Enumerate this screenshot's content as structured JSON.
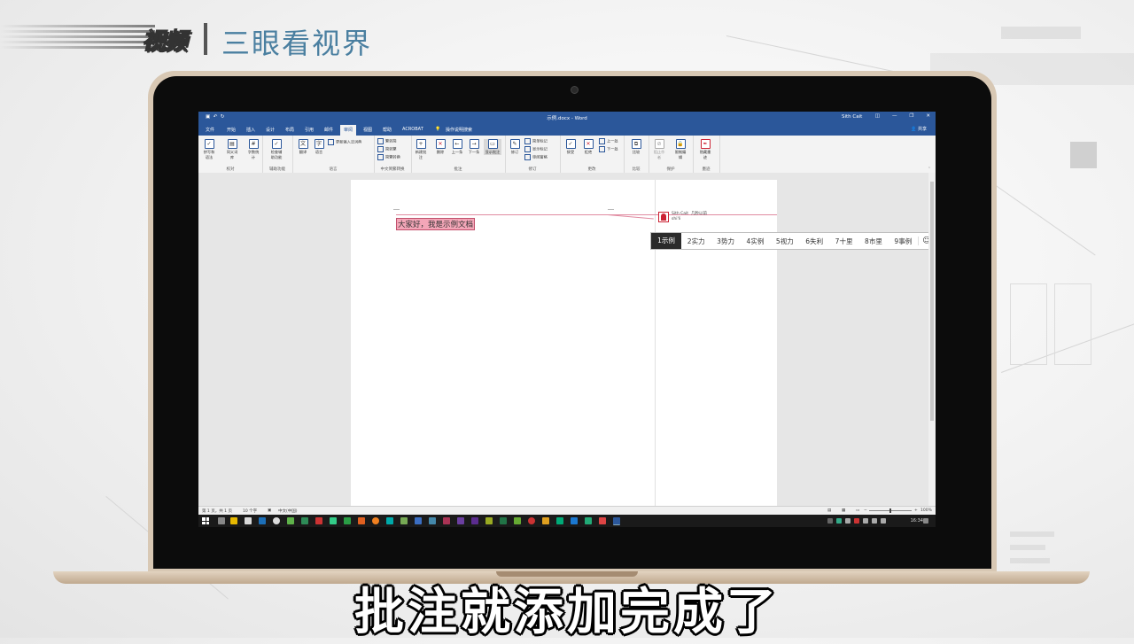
{
  "brand": {
    "video": "视频",
    "name": "三眼看视界"
  },
  "word": {
    "window_title": "示例.docx - Word",
    "user": "Sith Cait",
    "share": "共享",
    "tabs": [
      "文件",
      "开始",
      "插入",
      "设计",
      "布局",
      "引用",
      "邮件",
      "审阅",
      "视图",
      "帮助",
      "ACROBAT"
    ],
    "active_tab": "审阅",
    "tell_me": "操作说明搜索",
    "ribbon": {
      "proofing": {
        "buttons": [
          "拼写和语法",
          "同义词库",
          "字数统计"
        ],
        "label": "校对"
      },
      "accessibility": {
        "button": "检查辅助功能",
        "label": "辅助功能"
      },
      "language": {
        "buttons": [
          "翻译",
          "语言"
        ],
        "small": "更新输入法词典",
        "label": "语言"
      },
      "chinese": {
        "items": [
          "繁转简",
          "简转繁",
          "简繁转换"
        ],
        "label": "中文简繁转换"
      },
      "comments": {
        "buttons": [
          "新建批注",
          "删除",
          "上一条",
          "下一条",
          "显示批注"
        ],
        "label": "批注"
      },
      "tracking": {
        "button": "修订",
        "items": [
          "简单标记",
          "显示标记",
          "审阅窗格"
        ],
        "label": "修订"
      },
      "changes": {
        "buttons": [
          "接受",
          "拒绝"
        ],
        "items": [
          "上一处",
          "下一处"
        ],
        "label": "更改"
      },
      "compare": {
        "button": "比较",
        "label": "比较"
      },
      "protect": {
        "buttons": [
          "阻止作者",
          "限制编辑"
        ],
        "label": "保护"
      },
      "ink": {
        "button": "隐藏墨迹",
        "label": "墨迹"
      }
    },
    "document": {
      "commented_text": "大家好，我是示例文档",
      "comment_author": "Sith Cait",
      "comment_time": "几秒以前",
      "comment_text": "shi'li"
    },
    "ime_candidates": [
      "1示例",
      "2实力",
      "3势力",
      "4实例",
      "5视力",
      "6失利",
      "7十里",
      "8市里",
      "9事例"
    ],
    "status": {
      "page": "第 1 页，共 1 页",
      "words": "10 个字",
      "language": "中文(中国)",
      "zoom": "100%"
    },
    "clock": "16:34"
  },
  "subtitle": "批注就添加完成了"
}
